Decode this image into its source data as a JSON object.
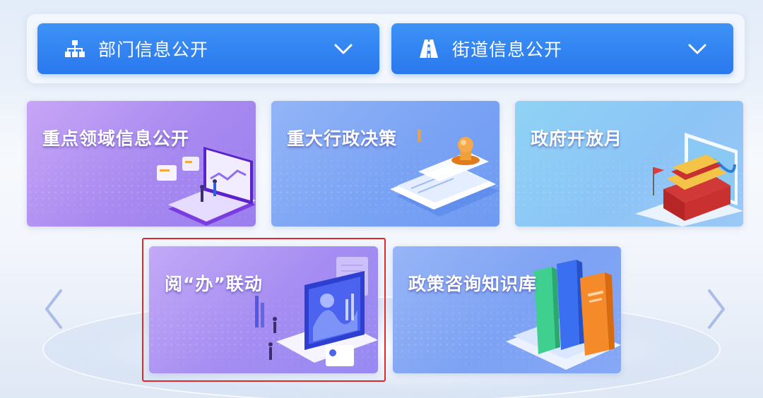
{
  "dropdowns": [
    {
      "label": "部门信息公开",
      "icon": "org-chart-icon"
    },
    {
      "label": "街道信息公开",
      "icon": "road-icon"
    }
  ],
  "cards": [
    {
      "title": "重点领域信息公开",
      "icon": "dashboard-screen-illustration"
    },
    {
      "title": "重大行政决策",
      "icon": "stamp-document-illustration"
    },
    {
      "title": "政府开放月",
      "icon": "tiananmen-illustration"
    },
    {
      "title": "阅“办”联动",
      "icon": "data-screen-illustration"
    },
    {
      "title": "政策咨询知识库",
      "icon": "books-illustration"
    }
  ],
  "colors": {
    "dropdown": "#2f83f1",
    "highlight_border": "#e02a2a"
  },
  "carousel": {
    "prev_icon": "chevron-left-icon",
    "next_icon": "chevron-right-icon"
  }
}
